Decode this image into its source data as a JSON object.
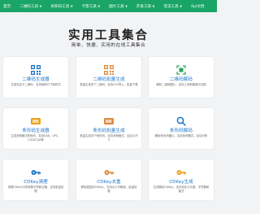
{
  "nav": {
    "items": [
      {
        "label": "首页",
        "has_dropdown": false
      },
      {
        "label": "二维码工具",
        "has_dropdown": true
      },
      {
        "label": "条形码工具",
        "has_dropdown": true
      },
      {
        "label": "卡密工具",
        "has_dropdown": true
      },
      {
        "label": "图片工具",
        "has_dropdown": true
      },
      {
        "label": "开发工具",
        "has_dropdown": true
      },
      {
        "label": "常见工具",
        "has_dropdown": true
      },
      {
        "label": "Api文档",
        "has_dropdown": false
      }
    ]
  },
  "hero": {
    "title": "实用工具集合",
    "subtitle": "简单、快捷、实用的在线工具集合"
  },
  "cards": [
    {
      "title": "二维码生成器",
      "desc": "生成自定义二维码，支持各种尺寸和样式",
      "icon": "qrcode-icon",
      "color": "#1a73c8"
    },
    {
      "title": "二维码批量生成",
      "desc": "批量生成多个二维码，支持CSV导入，批量下载",
      "icon": "qrcode-batch-icon",
      "color": "#e0883a"
    },
    {
      "title": "二维码解码",
      "desc": "解析二维码图片，支持上传和摄像头扫描",
      "icon": "scan-icon",
      "color": "#2aa35a"
    },
    {
      "title": "条形码生成器",
      "desc": "生成多种格式条形码，支持EAN、UPC、CODE128等",
      "icon": "barcode-icon",
      "color": "#e8a21a"
    },
    {
      "title": "条形码批量生成",
      "desc": "批量生成多个条形码，支持多种格式，自定义尺寸",
      "icon": "barcode-batch-icon",
      "color": "#e0883a"
    },
    {
      "title": "条形码解码",
      "desc": "解析条形码图片，支持多种格式，自动识别",
      "icon": "search-icon",
      "color": "#1a73c8"
    },
    {
      "title": "CDKey清理",
      "desc": "清理CDKey中的特殊字符和空格，支持批量处理",
      "icon": "key-icon",
      "color": "#1a73c8"
    },
    {
      "title": "CDKey去重",
      "desc": "移除重复的CDKey，支持大小写敏感，批量处理",
      "icon": "key-icon",
      "color": "#e0883a"
    },
    {
      "title": "CDKey生成",
      "desc": "生成随机CDKey，支持自定义长度、字符集和格式",
      "icon": "key-icon",
      "color": "#e8a21a"
    }
  ]
}
